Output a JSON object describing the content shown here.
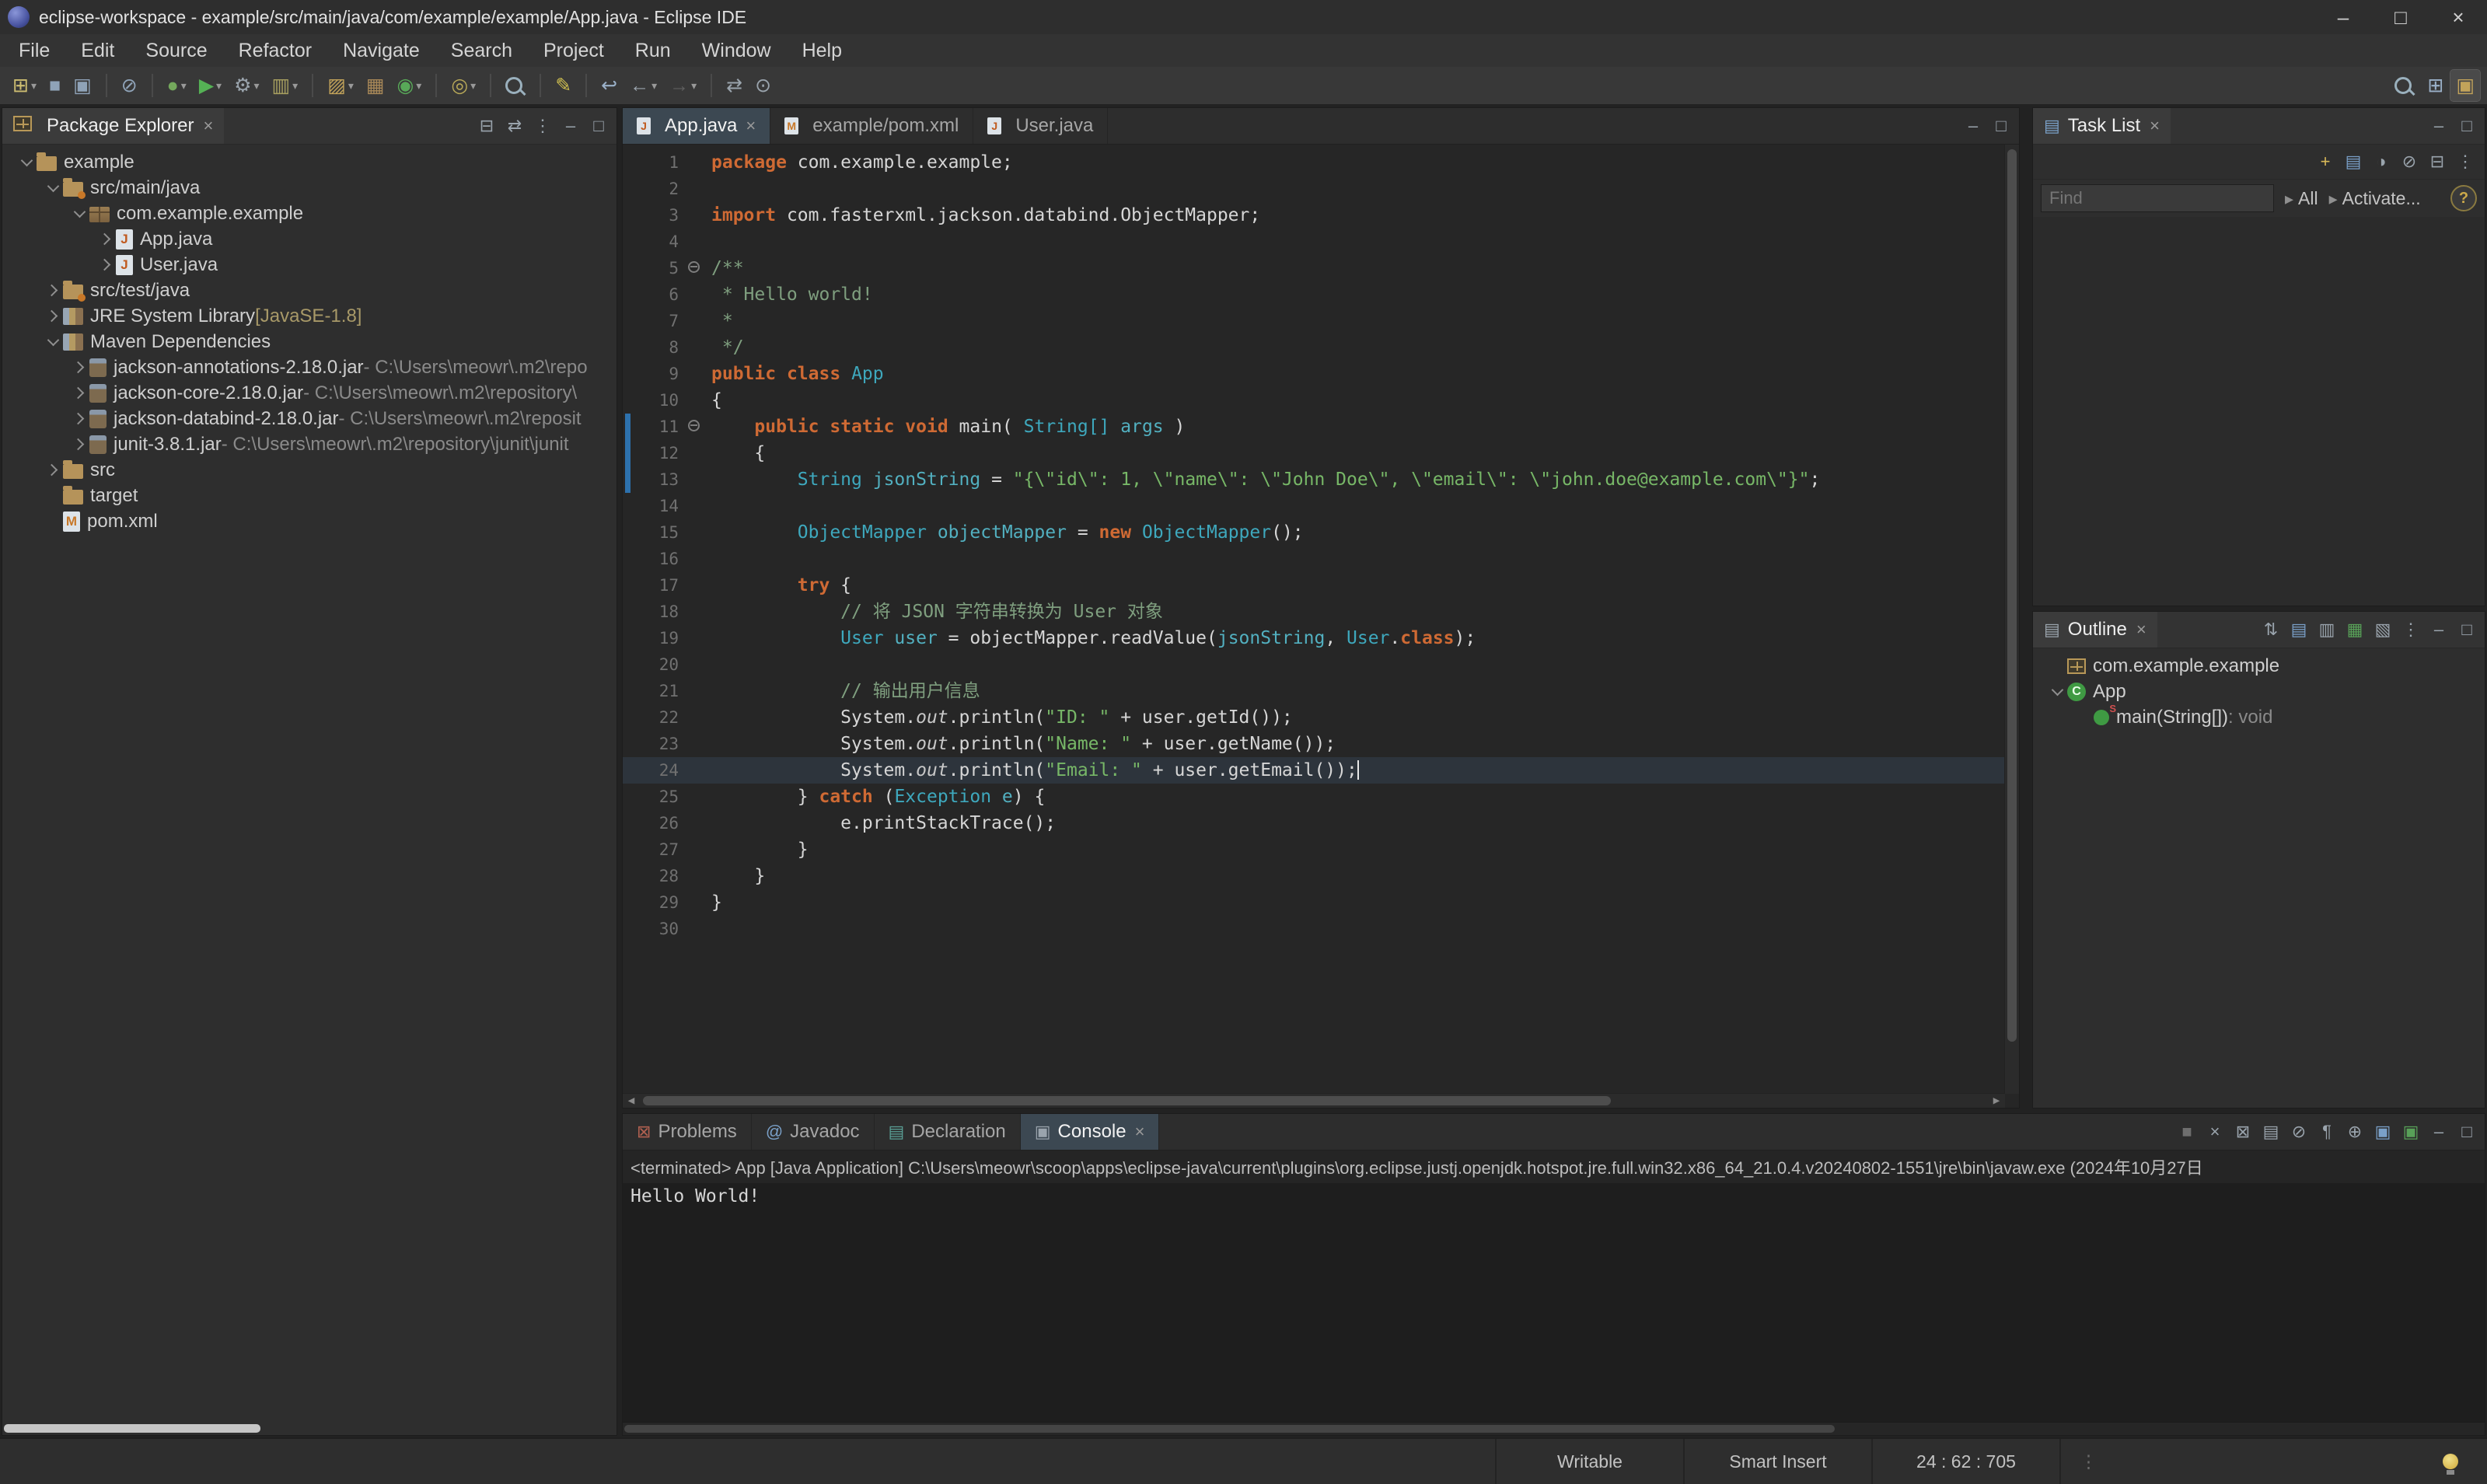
{
  "window": {
    "title": "eclipse-workspace - example/src/main/java/com/example/example/App.java - Eclipse IDE"
  },
  "menu": [
    "File",
    "Edit",
    "Source",
    "Refactor",
    "Navigate",
    "Search",
    "Project",
    "Run",
    "Window",
    "Help"
  ],
  "toolbar": {
    "items": [
      {
        "n": "new-wizard",
        "g": "⊞",
        "c": "#cdbd71",
        "dd": true
      },
      {
        "n": "save",
        "g": "■",
        "c": "#8fa3b8"
      },
      {
        "n": "save-all",
        "g": "▣",
        "c": "#8fa3b8"
      },
      {
        "sep": true
      },
      {
        "n": "skip-all-breakpoints",
        "g": "⊘",
        "c": "#8fa3b8"
      },
      {
        "sep": true
      },
      {
        "n": "debug",
        "g": "●",
        "c": "#74a85c",
        "dd": true
      },
      {
        "n": "run",
        "g": "▶",
        "c": "#55b155",
        "dd": true
      },
      {
        "n": "external-tools",
        "g": "⚙",
        "c": "#9aa4ad",
        "dd": true
      },
      {
        "n": "coverage",
        "g": "▥",
        "c": "#a8a060",
        "dd": true
      },
      {
        "sep": true
      },
      {
        "n": "new-java-project",
        "g": "▨",
        "c": "#c2a35a",
        "dd": true
      },
      {
        "n": "new-package",
        "g": "▦",
        "c": "#a88858"
      },
      {
        "n": "new-class",
        "g": "◉",
        "c": "#58a858",
        "dd": true
      },
      {
        "sep": true
      },
      {
        "n": "open-task",
        "g": "◎",
        "c": "#b8a858",
        "dd": true
      },
      {
        "sep": true
      },
      {
        "n": "search",
        "shape": "search"
      },
      {
        "sep": true
      },
      {
        "n": "mark-occurrences",
        "g": "✎",
        "c": "#d0c050"
      },
      {
        "sep": true
      },
      {
        "n": "last-edit-location",
        "g": "↩",
        "c": "#9ab0c8"
      },
      {
        "n": "back",
        "g": "←",
        "c": "#9aa4ad",
        "dd": true
      },
      {
        "n": "forward",
        "g": "→",
        "c": "#5f5f5f",
        "dd": true
      },
      {
        "sep": true
      },
      {
        "n": "link-with-editor",
        "g": "⇄",
        "c": "#9aa4ad"
      },
      {
        "n": "pin-editor",
        "g": "⊙",
        "c": "#9aa4ad"
      }
    ],
    "right": [
      {
        "n": "quick-access-search",
        "shape": "search"
      },
      {
        "n": "open-perspective",
        "g": "⊞",
        "c": "#9ab0c8"
      },
      {
        "n": "java-perspective",
        "g": "▣",
        "c": "#c2a35a",
        "pressed": true
      }
    ]
  },
  "glyphs": {
    "collapse-all": [
      "⊟",
      "#9aa4ad"
    ],
    "link-with-editor": [
      "⇄",
      "#9aa4ad"
    ],
    "view-menu": [
      "⋮",
      "#9aa4ad"
    ],
    "minimize": [
      "–",
      "#9aa4ad"
    ],
    "maximize": [
      "□",
      "#9aa4ad"
    ],
    "close": [
      "×",
      "#9a9a9a"
    ],
    "sort": [
      "⇅",
      "#9aa4ad"
    ],
    "hide-fields": [
      "▤",
      "#7aa0c8"
    ],
    "hide-static": [
      "▥",
      "#9aa4ad"
    ],
    "hide-nonpublic": [
      "▦",
      "#58a058"
    ],
    "hide-local-types": [
      "▧",
      "#9aa4ad"
    ],
    "terminate": [
      "■",
      "#6e6e6e"
    ],
    "remove-launch": [
      "×",
      "#9aa4ad"
    ],
    "remove-all": [
      "⊠",
      "#9aa4ad"
    ],
    "clear-console": [
      "▤",
      "#9aa4ad"
    ],
    "scroll-lock": [
      "⊘",
      "#9aa4ad"
    ],
    "word-wrap": [
      "¶",
      "#9aa4ad"
    ],
    "pin-console": [
      "⊕",
      "#9aa4ad"
    ],
    "display-selected": [
      "▣",
      "#7aa0c8"
    ],
    "open-console": [
      "▣",
      "#58a058"
    ],
    "new-task": [
      "+",
      "#d8b858"
    ],
    "categorized": [
      "▤",
      "#7aa0c8"
    ],
    "scheduled": [
      "◑",
      "#9aa4ad"
    ],
    "filter-completed": [
      "⊘",
      "#9aa4ad"
    ],
    "task-list": [
      "▤",
      "#7aa0c8"
    ],
    "outline": [
      "▤",
      "#9aa4ad"
    ],
    "problems": [
      "⊠",
      "#b06050"
    ],
    "javadoc": [
      "@",
      "#7aa0c8"
    ],
    "declaration": [
      "▤",
      "#5aa096"
    ],
    "console": [
      "▣",
      "#9aa4ad"
    ],
    "caret-right": [
      "▸",
      "#8f8f8f"
    ],
    "window-minimize": [
      "–",
      "#d0d0d0"
    ],
    "window-maximize": [
      "□",
      "#d0d0d0"
    ],
    "window-close": [
      "×",
      "#d0d0d0"
    ],
    "hscroll-left": [
      "◂",
      "#8a8a8a"
    ],
    "hscroll-right": [
      "▸",
      "#8a8a8a"
    ]
  },
  "package_explorer": {
    "title": "Package Explorer",
    "header_icons": [
      "collapse-all",
      "link-with-editor",
      "view-menu",
      "minimize",
      "maximize"
    ],
    "items": [
      {
        "depth": 0,
        "caret": "open",
        "icon": "project",
        "label": "example"
      },
      {
        "depth": 1,
        "caret": "open",
        "icon": "src-folder",
        "label": "src/main/java"
      },
      {
        "depth": 2,
        "caret": "open",
        "icon": "package",
        "label": "com.example.example"
      },
      {
        "depth": 3,
        "caret": "closed",
        "icon": "java-file",
        "label": "App.java"
      },
      {
        "depth": 3,
        "caret": "closed",
        "icon": "java-file",
        "label": "User.java"
      },
      {
        "depth": 1,
        "caret": "closed",
        "icon": "src-folder",
        "label": "src/test/java"
      },
      {
        "depth": 1,
        "caret": "closed",
        "icon": "library",
        "label": "JRE System Library ",
        "deco": "[JavaSE-1.8]"
      },
      {
        "depth": 1,
        "caret": "open",
        "icon": "library",
        "label": "Maven Dependencies"
      },
      {
        "depth": 2,
        "caret": "closed",
        "icon": "jar",
        "label": "jackson-annotations-2.18.0.jar",
        "suffix": " - C:\\Users\\meowr\\.m2\\repo"
      },
      {
        "depth": 2,
        "caret": "closed",
        "icon": "jar",
        "label": "jackson-core-2.18.0.jar",
        "suffix": " - C:\\Users\\meowr\\.m2\\repository\\"
      },
      {
        "depth": 2,
        "caret": "closed",
        "icon": "jar",
        "label": "jackson-databind-2.18.0.jar",
        "suffix": " - C:\\Users\\meowr\\.m2\\reposit"
      },
      {
        "depth": 2,
        "caret": "closed",
        "icon": "jar",
        "label": "junit-3.8.1.jar",
        "suffix": " - C:\\Users\\meowr\\.m2\\repository\\junit\\junit"
      },
      {
        "depth": 1,
        "caret": "closed",
        "icon": "folder",
        "label": "src"
      },
      {
        "depth": 1,
        "caret": "none",
        "icon": "folder",
        "label": "target"
      },
      {
        "depth": 1,
        "caret": "none",
        "icon": "xml-file",
        "label": "pom.xml"
      }
    ]
  },
  "editor": {
    "tabs": [
      {
        "label": "App.java",
        "icon": "java-file",
        "active": true,
        "closable": true
      },
      {
        "label": "example/pom.xml",
        "icon": "xml-file"
      },
      {
        "label": "User.java",
        "icon": "java-file"
      }
    ],
    "header_icons": [
      "minimize",
      "maximize"
    ],
    "lines": [
      {
        "n": 1,
        "tk": [
          [
            "kw",
            "package"
          ],
          [
            "pl",
            " com.example.example;"
          ]
        ]
      },
      {
        "n": 2,
        "tk": []
      },
      {
        "n": 3,
        "tk": [
          [
            "kw",
            "import"
          ],
          [
            "pl",
            " com.fasterxml.jackson.databind.ObjectMapper;"
          ]
        ]
      },
      {
        "n": 4,
        "tk": []
      },
      {
        "n": 5,
        "fold": true,
        "tk": [
          [
            "cm",
            "/**"
          ]
        ]
      },
      {
        "n": 6,
        "tk": [
          [
            "cm",
            " * Hello world!"
          ]
        ]
      },
      {
        "n": 7,
        "tk": [
          [
            "cm",
            " *"
          ]
        ]
      },
      {
        "n": 8,
        "tk": [
          [
            "cm",
            " */"
          ]
        ]
      },
      {
        "n": 9,
        "tk": [
          [
            "kw",
            "public"
          ],
          [
            "pl",
            " "
          ],
          [
            "kw",
            "class"
          ],
          [
            "pl",
            " "
          ],
          [
            "ty",
            "App"
          ]
        ]
      },
      {
        "n": 10,
        "tk": [
          [
            "pl",
            "{"
          ]
        ]
      },
      {
        "n": 11,
        "fold": true,
        "diff": true,
        "tk": [
          [
            "pl",
            "    "
          ],
          [
            "kw",
            "public"
          ],
          [
            "pl",
            " "
          ],
          [
            "kw",
            "static"
          ],
          [
            "pl",
            " "
          ],
          [
            "kw",
            "void"
          ],
          [
            "pl",
            " main( "
          ],
          [
            "ty",
            "String[]"
          ],
          [
            "pl",
            " "
          ],
          [
            "vr",
            "args"
          ],
          [
            "pl",
            " )"
          ]
        ]
      },
      {
        "n": 12,
        "diff": true,
        "tk": [
          [
            "pl",
            "    {"
          ]
        ]
      },
      {
        "n": 13,
        "diff": true,
        "tk": [
          [
            "pl",
            "        "
          ],
          [
            "ty",
            "String"
          ],
          [
            "pl",
            " "
          ],
          [
            "vr",
            "jsonString"
          ],
          [
            "pl",
            " = "
          ],
          [
            "st",
            "\"{\\\"id\\\": 1, \\\"name\\\": \\\"John Doe\\\", \\\"email\\\": \\\"john.doe@example.com\\\"}\""
          ],
          [
            "pl",
            ";"
          ]
        ]
      },
      {
        "n": 14,
        "tk": []
      },
      {
        "n": 15,
        "tk": [
          [
            "pl",
            "        "
          ],
          [
            "ty",
            "ObjectMapper"
          ],
          [
            "pl",
            " "
          ],
          [
            "vr",
            "objectMapper"
          ],
          [
            "pl",
            " = "
          ],
          [
            "kw",
            "new"
          ],
          [
            "pl",
            " "
          ],
          [
            "ty",
            "ObjectMapper"
          ],
          [
            "pl",
            "();"
          ]
        ]
      },
      {
        "n": 16,
        "tk": []
      },
      {
        "n": 17,
        "tk": [
          [
            "pl",
            "        "
          ],
          [
            "kw",
            "try"
          ],
          [
            "pl",
            " {"
          ]
        ]
      },
      {
        "n": 18,
        "tk": [
          [
            "cm",
            "            // 将 JSON 字符串转换为 User 对象"
          ]
        ]
      },
      {
        "n": 19,
        "tk": [
          [
            "pl",
            "            "
          ],
          [
            "ty",
            "User"
          ],
          [
            "pl",
            " "
          ],
          [
            "vr",
            "user"
          ],
          [
            "pl",
            " = objectMapper.readValue("
          ],
          [
            "vr",
            "jsonString"
          ],
          [
            "pl",
            ", "
          ],
          [
            "ty",
            "User"
          ],
          [
            "pl",
            "."
          ],
          [
            "kw",
            "class"
          ],
          [
            "pl",
            ");"
          ]
        ]
      },
      {
        "n": 20,
        "tk": []
      },
      {
        "n": 21,
        "tk": [
          [
            "cm",
            "            // 输出用户信息"
          ]
        ]
      },
      {
        "n": 22,
        "tk": [
          [
            "pl",
            "            System."
          ],
          [
            "fd",
            "out"
          ],
          [
            "pl",
            ".println("
          ],
          [
            "st",
            "\"ID: \""
          ],
          [
            "pl",
            " + user.getId());"
          ]
        ]
      },
      {
        "n": 23,
        "tk": [
          [
            "pl",
            "            System."
          ],
          [
            "fd",
            "out"
          ],
          [
            "pl",
            ".println("
          ],
          [
            "st",
            "\"Name: \""
          ],
          [
            "pl",
            " + user.getName());"
          ]
        ]
      },
      {
        "n": 24,
        "cur": true,
        "cursor": true,
        "tk": [
          [
            "pl",
            "            System."
          ],
          [
            "fd",
            "out"
          ],
          [
            "pl",
            ".println("
          ],
          [
            "st",
            "\"Email: \""
          ],
          [
            "pl",
            " + user.getEmail());"
          ]
        ]
      },
      {
        "n": 25,
        "tk": [
          [
            "pl",
            "        } "
          ],
          [
            "kw",
            "catch"
          ],
          [
            "pl",
            " ("
          ],
          [
            "ty",
            "Exception"
          ],
          [
            "pl",
            " "
          ],
          [
            "vr",
            "e"
          ],
          [
            "pl",
            ") {"
          ]
        ]
      },
      {
        "n": 26,
        "tk": [
          [
            "pl",
            "            e.printStackTrace();"
          ]
        ]
      },
      {
        "n": 27,
        "tk": [
          [
            "pl",
            "        }"
          ]
        ]
      },
      {
        "n": 28,
        "tk": [
          [
            "pl",
            "    }"
          ]
        ]
      },
      {
        "n": 29,
        "tk": [
          [
            "pl",
            "}"
          ]
        ]
      },
      {
        "n": 30,
        "tk": []
      }
    ]
  },
  "task_list": {
    "title": "Task List",
    "header_icons": [
      "minimize",
      "maximize"
    ],
    "toolbar_icons": [
      "new-task",
      "categorized",
      "scheduled",
      "filter-completed",
      "collapse-all",
      "view-menu"
    ],
    "find_placeholder": "Find",
    "all_label": "All",
    "activate_label": "Activate...",
    "help_label": "?"
  },
  "outline": {
    "title": "Outline",
    "header_icons": [
      "sort",
      "hide-fields",
      "hide-static",
      "hide-nonpublic",
      "hide-local-types",
      "view-menu",
      "minimize",
      "maximize"
    ],
    "items": [
      {
        "depth": 0,
        "caret": "none",
        "icon": "package-decl",
        "label": "com.example.example"
      },
      {
        "depth": 0,
        "caret": "open",
        "icon": "class",
        "label": "App"
      },
      {
        "depth": 1,
        "caret": "none",
        "icon": "method",
        "label": "main(String[])",
        "suffix": " : void"
      }
    ]
  },
  "console": {
    "tabs": [
      {
        "label": "Problems",
        "icon": "problems"
      },
      {
        "label": "Javadoc",
        "icon": "javadoc"
      },
      {
        "label": "Declaration",
        "icon": "declaration"
      },
      {
        "label": "Console",
        "icon": "console",
        "active": true,
        "closable": true
      }
    ],
    "header_icons": [
      "terminate",
      "remove-launch",
      "remove-all",
      "clear-console",
      "scroll-lock",
      "word-wrap",
      "pin-console",
      "display-selected",
      "open-console",
      "minimize",
      "maximize"
    ],
    "header": "<terminated> App [Java Application] C:\\Users\\meowr\\scoop\\apps\\eclipse-java\\current\\plugins\\org.eclipse.justj.openjdk.hotspot.jre.full.win32.x86_64_21.0.4.v20240802-1551\\jre\\bin\\javaw.exe (2024年10月27日",
    "output": "Hello World!"
  },
  "status_bar": {
    "writable": "Writable",
    "insert_mode": "Smart Insert",
    "position": "24 : 62 : 705"
  },
  "colors": {
    "accent_blue": "#2d71ad",
    "keyword": "#cf6a34",
    "type": "#3ea8bd",
    "string": "#77b767",
    "comment": "#7f9f7f",
    "editor_background": "#262626"
  }
}
